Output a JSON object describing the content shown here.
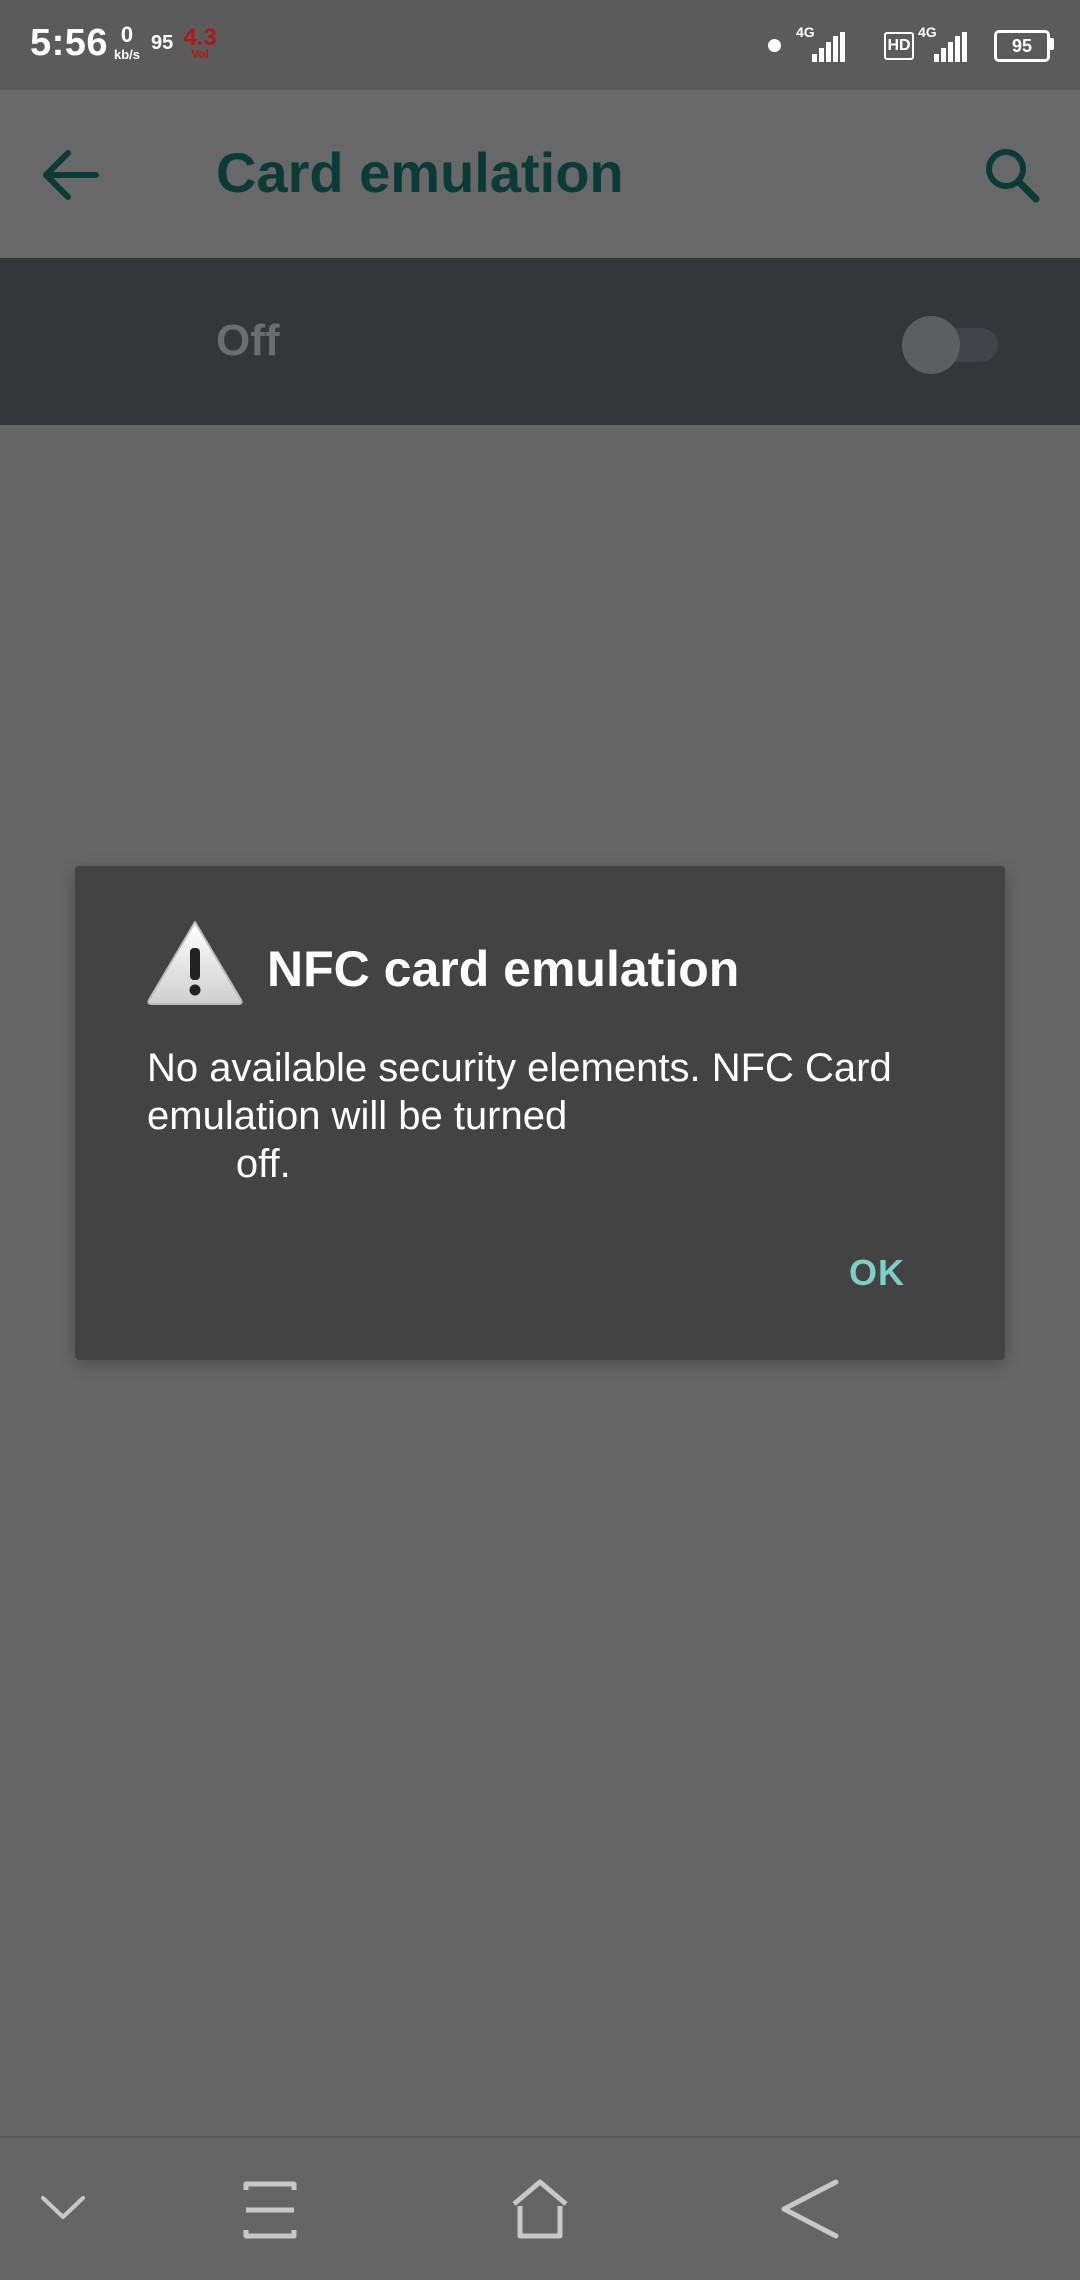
{
  "status_bar": {
    "time": "5:56",
    "speed_value": "0",
    "speed_unit": "kb/s",
    "left_number": "95",
    "volte_value": "4.3",
    "volte_unit": "Vol",
    "network_1": "4G",
    "hd_label": "HD",
    "network_2": "4G",
    "battery": "95",
    "icons": [
      "dot-icon",
      "signal-icon",
      "hd-icon",
      "signal-icon",
      "battery-icon"
    ]
  },
  "app_bar": {
    "title": "Card emulation",
    "title_color": "#0b3b35",
    "back_icon": "arrow-left-icon",
    "search_icon": "search-icon"
  },
  "toggle": {
    "label": "Off",
    "state": "off"
  },
  "dialog": {
    "icon": "warning-icon",
    "title": "NFC card emulation",
    "message": "No available security elements. NFC Card\nemulation will be turned\n        off.",
    "ok_label": "OK",
    "accent_color": "#7ecfc7"
  },
  "nav_bar": {
    "icons": [
      "chevron-down-icon",
      "recents-icon",
      "home-icon",
      "back-icon"
    ]
  }
}
